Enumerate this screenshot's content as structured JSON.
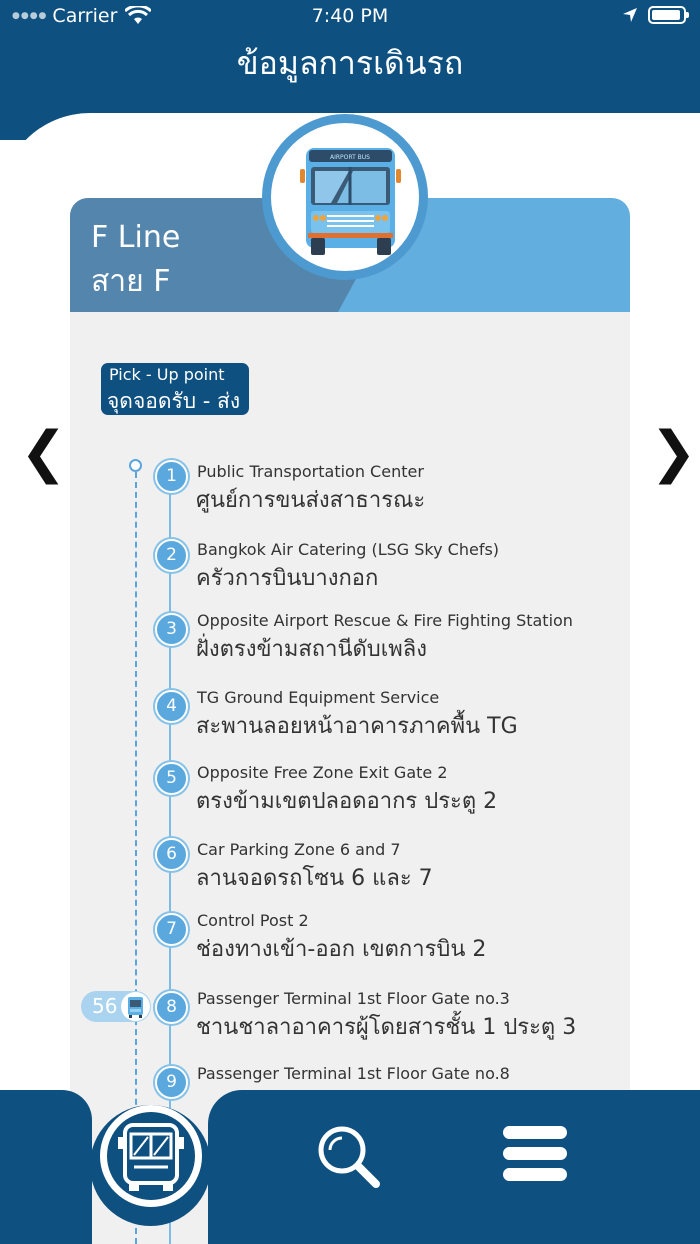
{
  "status_bar": {
    "carrier": "Carrier",
    "time": "7:40 PM"
  },
  "header": {
    "title": "ข้อมูลการเดินรถ"
  },
  "line": {
    "name_en": "F Line",
    "name_th": "สาย F"
  },
  "bus_icon": "airport-bus-icon",
  "bus_sign": "AIRPORT BUS",
  "pickup_label": {
    "en": "Pick - Up point",
    "th": "จุดจอดรับ - ส่ง"
  },
  "nav": {
    "prev": "❮",
    "next": "❯"
  },
  "stops": [
    {
      "num": "1",
      "en": "Public Transportation Center",
      "th": "ศูนย์การขนส่งสาธารณะ"
    },
    {
      "num": "2",
      "en": "Bangkok Air Catering (LSG Sky Chefs)",
      "th": "ครัวการบินบางกอก"
    },
    {
      "num": "3",
      "en": "Opposite Airport Rescue & Fire Fighting Station",
      "th": "ฝั่งตรงข้ามสถานีดับเพลิง"
    },
    {
      "num": "4",
      "en": "TG Ground Equipment Service",
      "th": "สะพานลอยหน้าอาคารภาคพื้น TG"
    },
    {
      "num": "5",
      "en": "Opposite Free Zone Exit Gate 2",
      "th": "ตรงข้ามเขตปลอดอากร ประตู 2"
    },
    {
      "num": "6",
      "en": "Car Parking Zone 6 and 7",
      "th": "ลานจอดรถโซน 6 และ 7"
    },
    {
      "num": "7",
      "en": "Control Post 2",
      "th": "ช่องทางเข้า-ออก เขตการบิน 2"
    },
    {
      "num": "8",
      "en": "Passenger Terminal 1st Floor Gate  no.3",
      "th": "ชานชาลาอาคารผู้โดยสารชั้น 1 ประตู 3"
    },
    {
      "num": "9",
      "en": "Passenger Terminal 1st Floor Gate  no.8",
      "th": ""
    }
  ],
  "bus_position": {
    "bus_number": "56",
    "at_stop": "8"
  },
  "tab_bar": {
    "items": [
      {
        "icon": "bus-icon",
        "active": true
      },
      {
        "icon": "search-icon",
        "active": false
      },
      {
        "icon": "menu-icon",
        "active": false
      }
    ]
  },
  "colors": {
    "primary": "#0e5080",
    "accent": "#5aa8dd",
    "header_panel_dark": "#5485ac",
    "header_panel_light": "#62aede"
  }
}
